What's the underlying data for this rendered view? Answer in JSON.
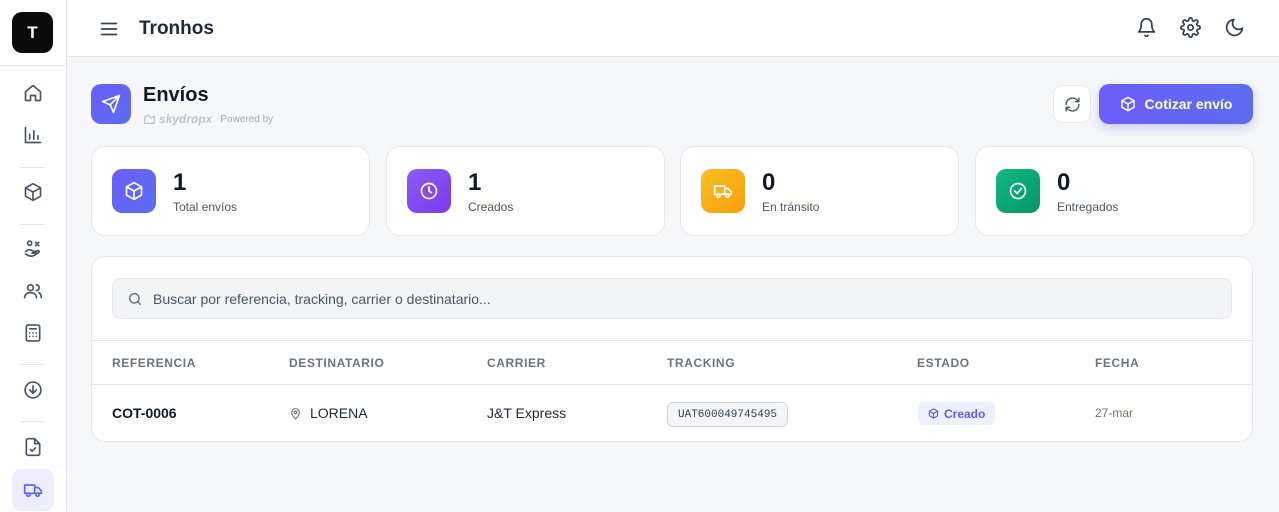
{
  "sidebar": {
    "brand_letter": "T",
    "items": [
      {
        "icon": "home-icon"
      },
      {
        "icon": "bar-chart-icon"
      },
      {
        "icon": "package-icon"
      },
      {
        "icon": "hand-coins-icon"
      },
      {
        "icon": "users-icon"
      },
      {
        "icon": "calculator-icon"
      },
      {
        "icon": "download-circle-icon"
      },
      {
        "icon": "clipboard-check-icon"
      },
      {
        "icon": "truck-icon",
        "active": true
      }
    ]
  },
  "topbar": {
    "title": "Tronhos",
    "icons": [
      "bell-icon",
      "gear-icon",
      "moon-icon"
    ]
  },
  "header": {
    "title": "Envíos",
    "logo_text": "skydropx",
    "powered_label": "Powered by",
    "quote_button": "Cotizar envío"
  },
  "stats": [
    {
      "value": "1",
      "label": "Total envíos",
      "color": "#6366f1",
      "icon": "package-icon"
    },
    {
      "value": "1",
      "label": "Creados",
      "color": "#8b5cf6",
      "icon": "clock-icon"
    },
    {
      "value": "0",
      "label": "En tránsito",
      "color": "#f59e0b",
      "icon": "truck-icon"
    },
    {
      "value": "0",
      "label": "Entregados",
      "color": "#10b981",
      "icon": "check-circle-icon"
    }
  ],
  "search": {
    "placeholder": "Buscar por referencia, tracking, carrier o destinatario..."
  },
  "table": {
    "columns": [
      "REFERENCIA",
      "DESTINATARIO",
      "CARRIER",
      "TRACKING",
      "ESTADO",
      "FECHA"
    ],
    "rows": [
      {
        "reference": "COT-0006",
        "recipient": "LORENA",
        "carrier": "J&T Express",
        "tracking": "UAT600049745495",
        "status": "Creado",
        "date": "27-mar"
      }
    ]
  }
}
